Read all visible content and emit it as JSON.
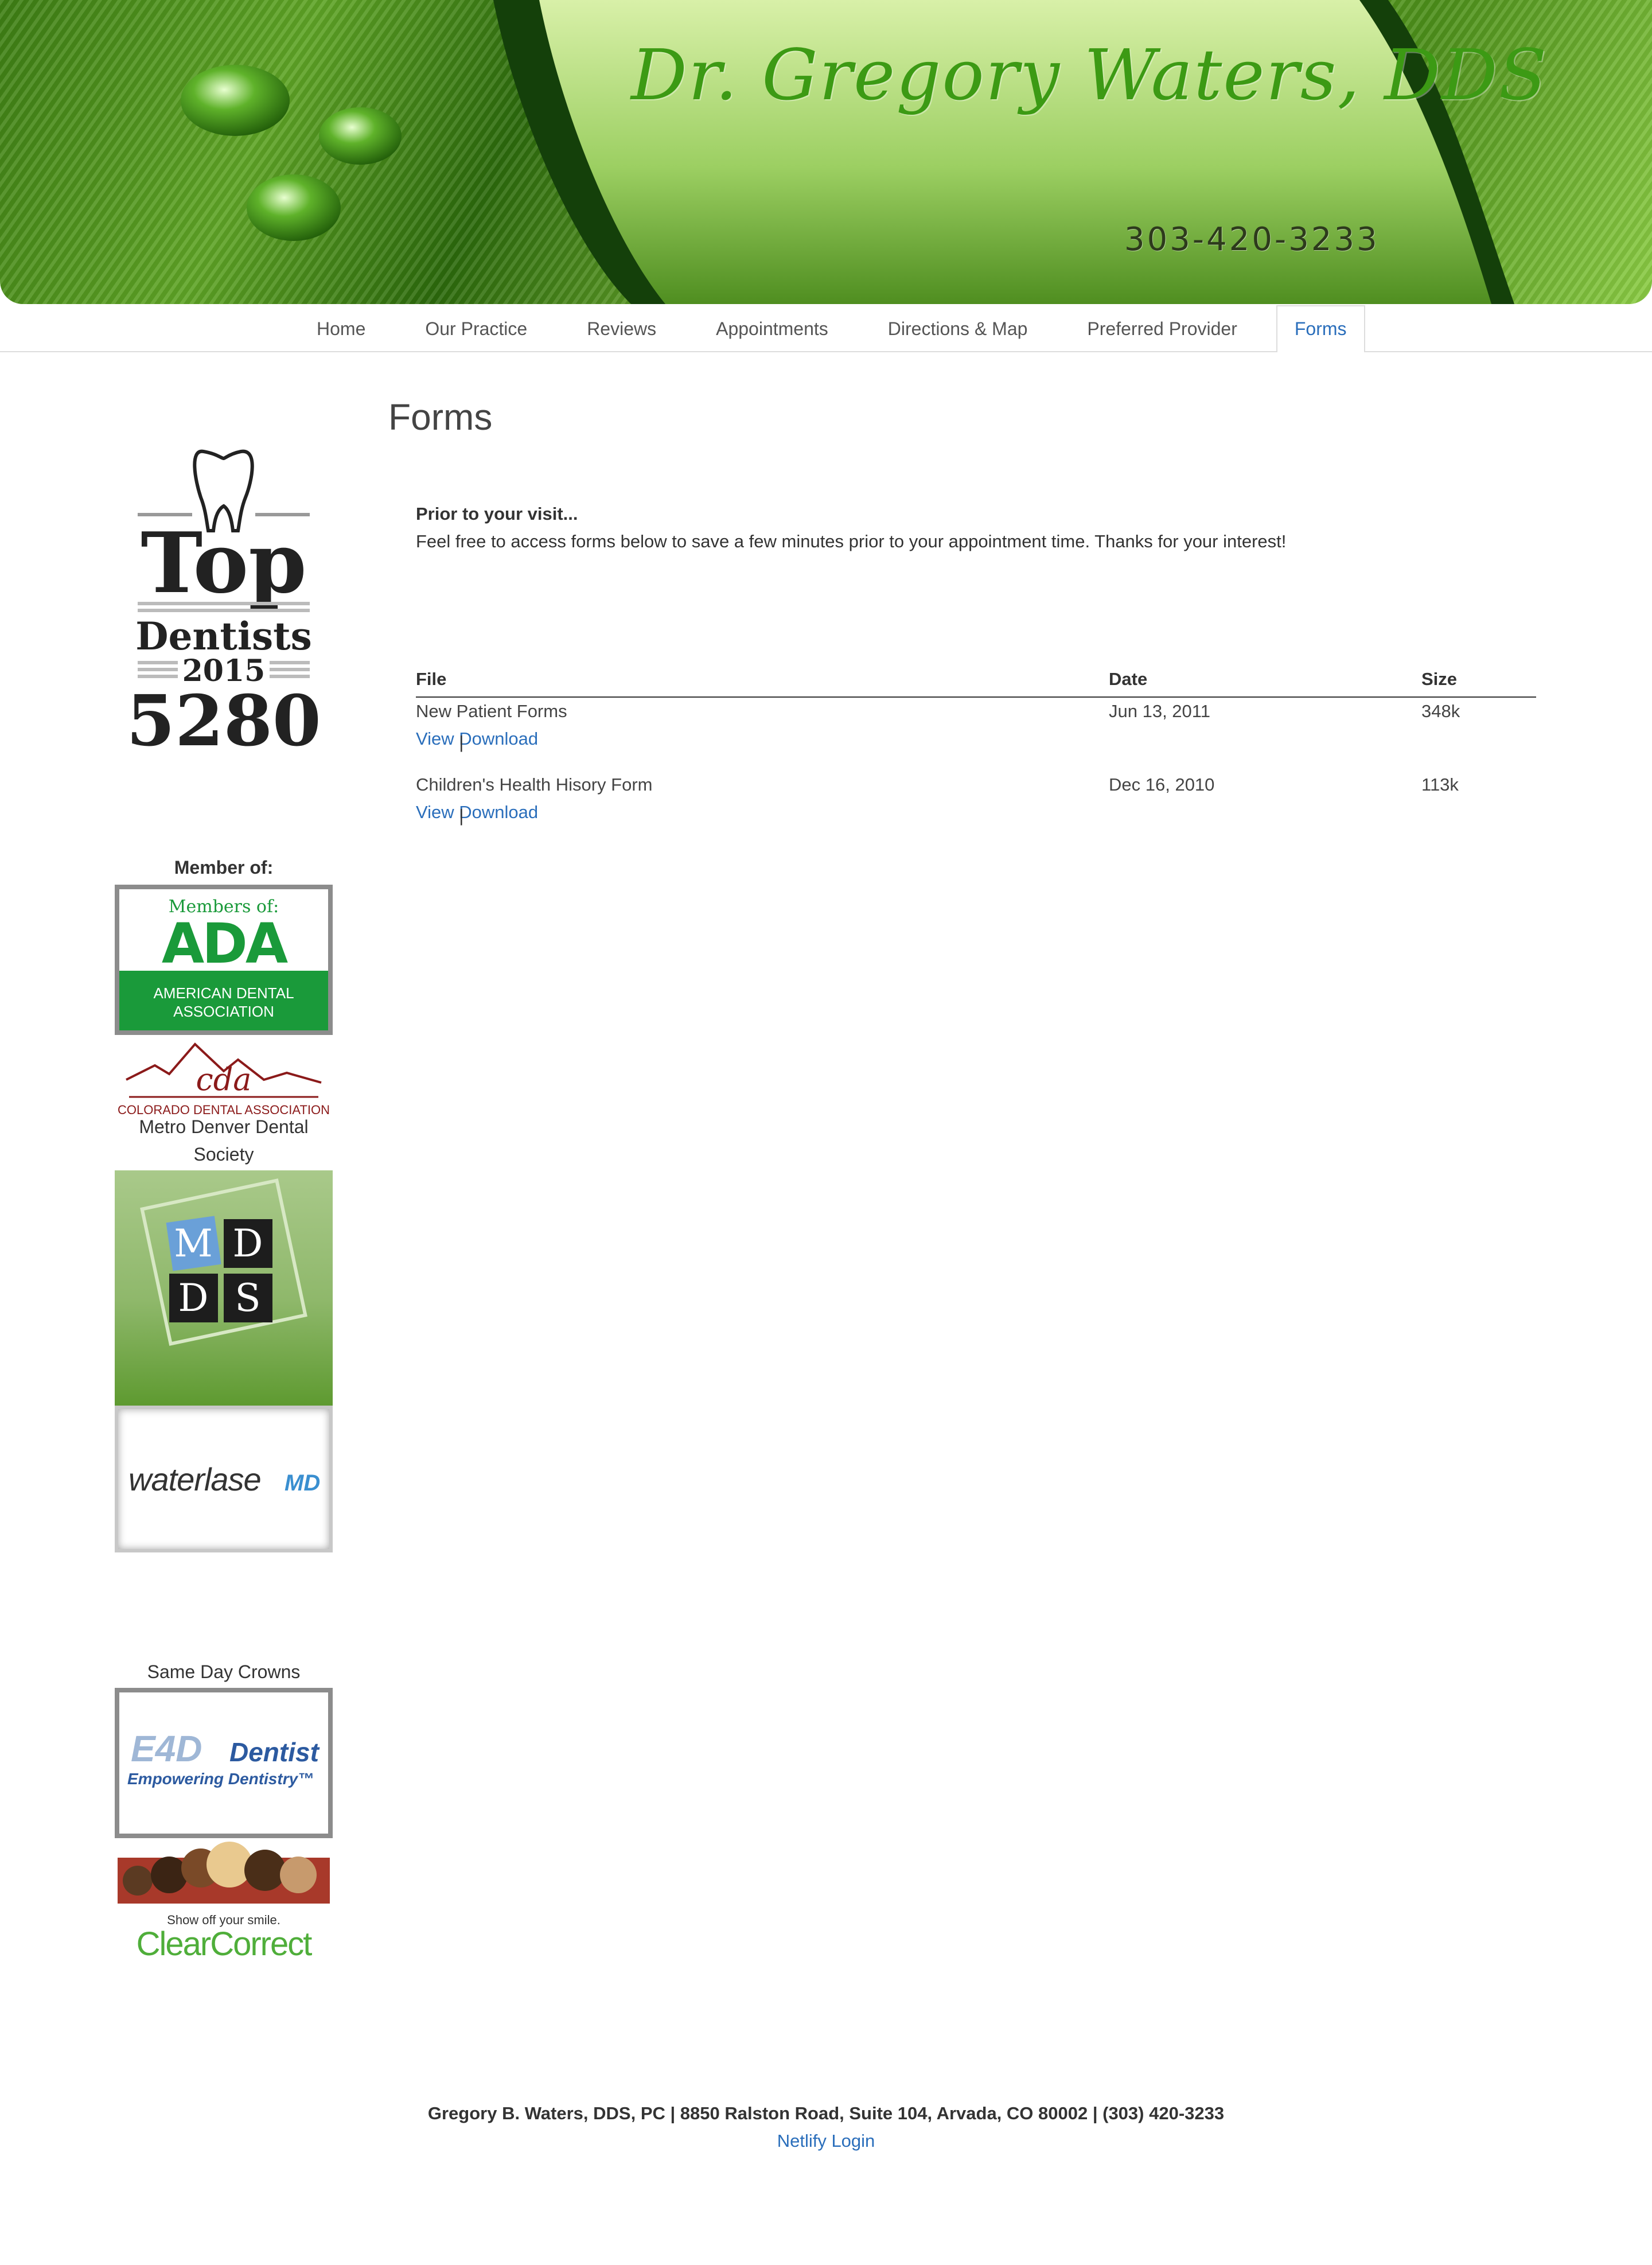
{
  "banner": {
    "title": "Dr. Gregory Waters, DDS",
    "phone": "303-420-3233"
  },
  "nav": {
    "items": [
      {
        "label": "Home"
      },
      {
        "label": "Our Practice"
      },
      {
        "label": "Reviews"
      },
      {
        "label": "Appointments"
      },
      {
        "label": "Directions & Map"
      },
      {
        "label": "Preferred Provider"
      },
      {
        "label": "Forms",
        "active": true
      }
    ]
  },
  "sidebar": {
    "top_dentist": {
      "line1": "Top",
      "line2": "Dentists",
      "year": "2015",
      "number": "5280"
    },
    "member_label": "Member of:",
    "ada": {
      "top": "Members of:",
      "logo": "ADA",
      "bottom1": "AMERICAN DENTAL",
      "bottom2": "ASSOCIATION"
    },
    "cda": {
      "logo": "cda",
      "caption": "COLORADO DENTAL ASSOCIATION"
    },
    "mdds_label": "Metro Denver Dental Society",
    "mdds_letters": [
      "M",
      "D",
      "D",
      "S"
    ],
    "waterlase": {
      "text": "waterlase",
      "suffix": "MD"
    },
    "crowns_label": "Same Day Crowns",
    "e4d": {
      "brand": "E4D",
      "word": "Dentist",
      "tagline": "Empowering Dentistry™"
    },
    "clearcorrect": {
      "tagline": "Show off your smile.",
      "brand": "ClearCorrect"
    }
  },
  "main": {
    "heading": "Forms",
    "intro_title": "Prior to your visit...",
    "intro_text": "Feel free to access forms below to save a few minutes prior to your appointment time. Thanks for your interest!",
    "table": {
      "headers": {
        "file": "File",
        "date": "Date",
        "size": "Size"
      },
      "rows": [
        {
          "file": "New Patient Forms",
          "date": "Jun 13, 2011",
          "size": "348k",
          "view": "View",
          "sep": "|",
          "download": "Download"
        },
        {
          "file": "Children's Health Hisory Form",
          "date": "Dec 16, 2010",
          "size": "113k",
          "view": "View",
          "sep": "|",
          "download": "Download"
        }
      ]
    }
  },
  "footer": {
    "address": "Gregory B. Waters, DDS, PC | 8850 Ralston Road, Suite 104, Arvada, CO 80002 | (303) 420-3233",
    "link": "Netlify Login"
  },
  "colors": {
    "link": "#2a6ebb",
    "banner_green": "#5fa526",
    "ada_green": "#1a9a3a",
    "cda_red": "#8b1a1a"
  }
}
